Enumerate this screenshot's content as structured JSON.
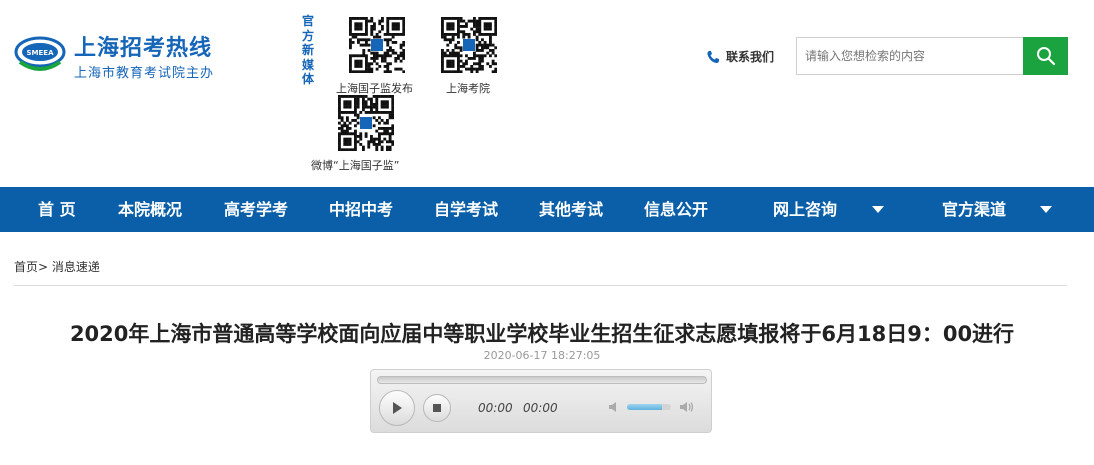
{
  "header": {
    "site_title": "上海招考热线",
    "site_subtitle": "上海市教育考试院主办",
    "logo_text": "SMEEA",
    "media_label": "官方新媒体",
    "qr_codes": [
      {
        "caption": "上海国子监发布"
      },
      {
        "caption": "上海考院"
      },
      {
        "caption": "微博“上海国子监”"
      }
    ],
    "contact_label": "联系我们",
    "search": {
      "placeholder": "请输入您想检索的内容",
      "value": ""
    },
    "colors": {
      "brand": "#1565b8",
      "search_button": "#1aa33f"
    }
  },
  "nav": {
    "items": [
      {
        "label": "首 页"
      },
      {
        "label": "本院概况"
      },
      {
        "label": "高考学考"
      },
      {
        "label": "中招中考"
      },
      {
        "label": "自学考试"
      },
      {
        "label": "其他考试"
      },
      {
        "label": "信息公开"
      },
      {
        "label": "网上咨询",
        "dropdown": true
      },
      {
        "label": "官方渠道",
        "dropdown": true
      }
    ],
    "color": "#0a5fa8"
  },
  "breadcrumb": {
    "home": "首页",
    "separator": ">",
    "current": "消息速递"
  },
  "article": {
    "title": "2020年上海市普通高等学校面向应届中等职业学校毕业生招生征求志愿填报将于6月18日9：00进行",
    "date": "2020-06-17 18:27:05"
  },
  "player": {
    "current_time": "00:00",
    "duration": "00:00",
    "volume_level": 0.8,
    "progress": 0
  }
}
